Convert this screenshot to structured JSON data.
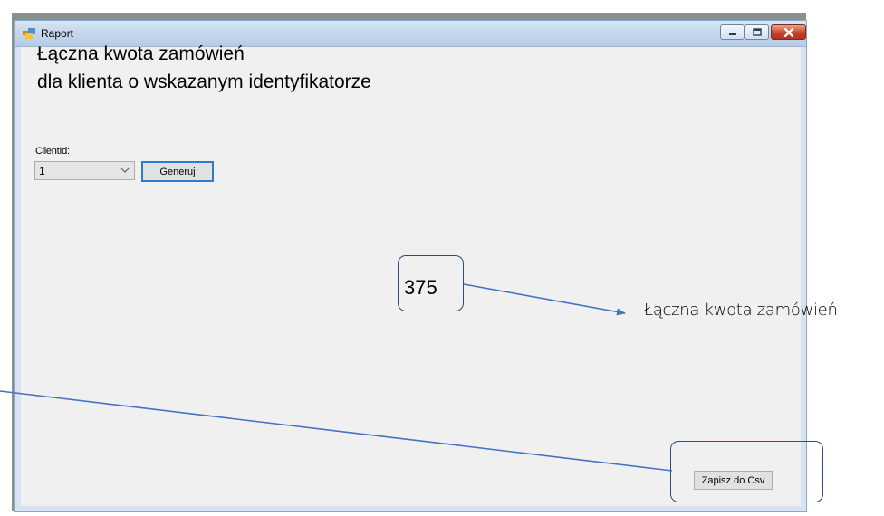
{
  "window": {
    "title": "Raport",
    "controls": [
      "minimize",
      "maximize",
      "close"
    ]
  },
  "form": {
    "heading_line1": "Łączna kwota zamówień",
    "heading_line2": "dla klienta o wskazanym identyfikatorze",
    "client_label": "ClientId:",
    "client_selected": "1",
    "generate_label": "Generuj",
    "result_value": "375",
    "save_label": "Zapisz do Csv"
  },
  "annotations": {
    "result_caption": "Łączna kwota zamówień"
  },
  "colors": {
    "callout_line": "#4472c4",
    "callout_border": "#2f4b7c",
    "focus_border": "#2b7bd0",
    "close_button": "#c4442a"
  }
}
